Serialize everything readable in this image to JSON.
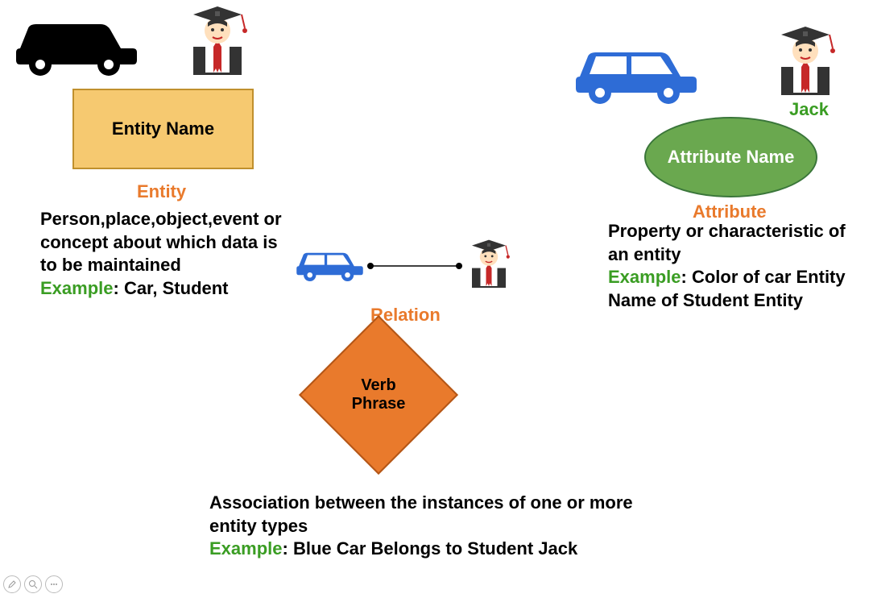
{
  "entity": {
    "box_label": "Entity Name",
    "title": "Entity",
    "description": "Person,place,object,event or concept about which data is to be maintained",
    "example_label": "Example",
    "example_text": ": Car, Student"
  },
  "relation": {
    "title": "Relation",
    "diamond_label": "Verb Phrase",
    "description": "Association between the instances of one or more entity types",
    "example_label": "Example",
    "example_text": ": Blue Car Belongs to Student Jack"
  },
  "attribute": {
    "student_name": "Jack",
    "ellipse_label": "Attribute Name",
    "title": "Attribute",
    "description": "Property or characteristic of an entity",
    "example_label": "Example",
    "example_text": ": Color of car Entity Name of Student Entity"
  },
  "icons": {
    "car_black": "car-icon",
    "car_blue": "car-icon",
    "student": "graduate-icon"
  }
}
